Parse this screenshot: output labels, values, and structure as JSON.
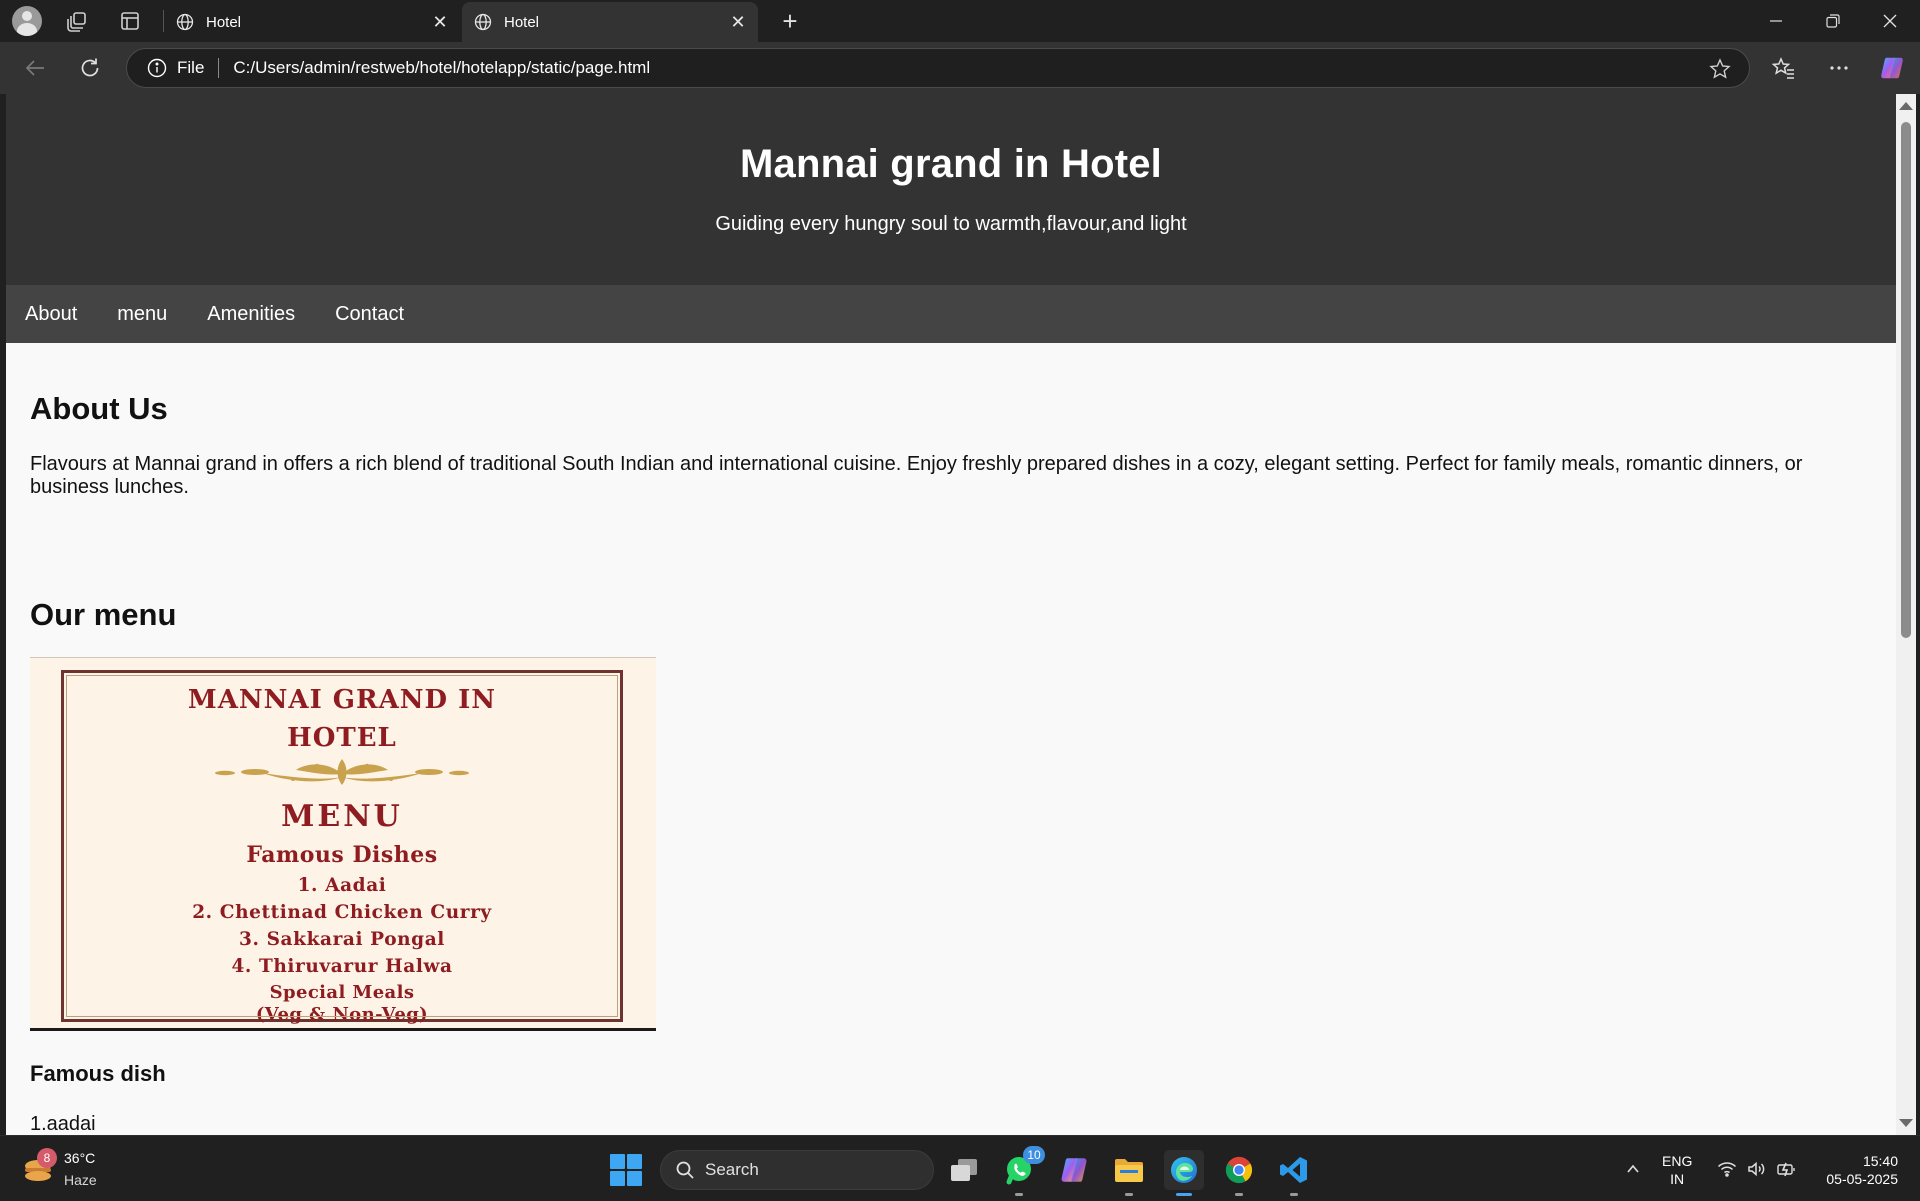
{
  "browser": {
    "tabs": [
      {
        "title": "Hotel"
      },
      {
        "title": "Hotel"
      }
    ],
    "address": {
      "scheme_label": "File",
      "url": "C:/Users/admin/restweb/hotel/hotelapp/static/page.html"
    },
    "icons": {
      "back": "back-arrow-icon",
      "reload": "reload-icon",
      "favorite": "star-icon",
      "favorites": "favorites-icon",
      "more": "more-icon",
      "copilot": "copilot-icon"
    }
  },
  "site": {
    "title": "Mannai grand in Hotel",
    "tagline": "Guiding every hungry soul to warmth,flavour,and light",
    "nav": [
      "About",
      "menu",
      "Amenities",
      "Contact"
    ],
    "about": {
      "heading": "About Us",
      "text": "Flavours at Mannai grand in offers a rich blend of traditional South Indian and international cuisine. Enjoy freshly prepared dishes in a cozy, elegant setting. Perfect for family meals, romantic dinners, or business lunches."
    },
    "menu": {
      "heading": "Our menu",
      "image": {
        "line1": "MANNAI GRAND IN",
        "line2": "HOTEL",
        "title": "MENU",
        "subtitle": "Famous Dishes",
        "items": [
          "1. Aadai",
          "2. Chettinad Chicken Curry",
          "3. Sakkarai Pongal",
          "4. Thiruvarur Halwa"
        ],
        "special_line1": "Special Meals",
        "special_line2": "(Veg & Non-Veg)"
      },
      "famous_heading": "Famous dish",
      "famous_items": [
        "1.aadai"
      ]
    }
  },
  "taskbar": {
    "weather": {
      "temp": "36°C",
      "desc": "Haze",
      "badge": "8"
    },
    "search_placeholder": "Search",
    "whatsapp_badge": "10",
    "language": {
      "line1": "ENG",
      "line2": "IN"
    },
    "clock": {
      "time": "15:40",
      "date": "05-05-2025"
    }
  },
  "colors": {
    "header_bg": "#333333",
    "nav_bg": "#444444",
    "page_bg": "#f9f9f9",
    "menu_text": "#8e1c20",
    "accent_blue": "#3ea7f4"
  }
}
